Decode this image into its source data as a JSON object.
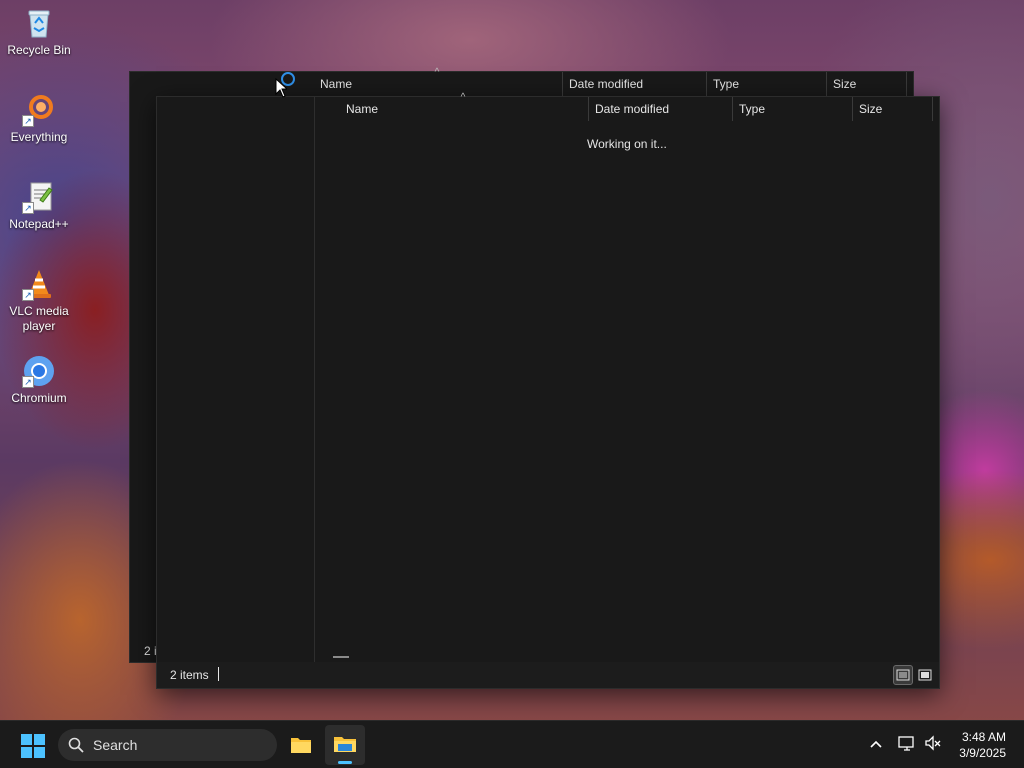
{
  "desktop": {
    "icons": [
      {
        "label": "Recycle Bin",
        "icon": "recycle-bin-icon"
      },
      {
        "label": "Everything",
        "icon": "everything-search-icon"
      },
      {
        "label": "Notepad++",
        "icon": "notepad-plus-plus-icon"
      },
      {
        "label": "VLC media player",
        "icon": "vlc-cone-icon"
      },
      {
        "label": "Chromium",
        "icon": "chromium-icon"
      }
    ]
  },
  "back_window": {
    "columns": {
      "name": "Name",
      "date_modified": "Date modified",
      "type": "Type",
      "size": "Size"
    },
    "status_partial": "2 i"
  },
  "front_window": {
    "columns": {
      "name": "Name",
      "date_modified": "Date modified",
      "type": "Type",
      "size": "Size"
    },
    "loading_text": "Working on it...",
    "status_items": "2 items"
  },
  "taskbar": {
    "search_placeholder": "Search",
    "clock_time": "3:48 AM",
    "clock_date": "3/9/2025"
  },
  "colors": {
    "window_bg": "#191919",
    "taskbar_bg": "#1b1b1b",
    "accent": "#0078d4"
  }
}
